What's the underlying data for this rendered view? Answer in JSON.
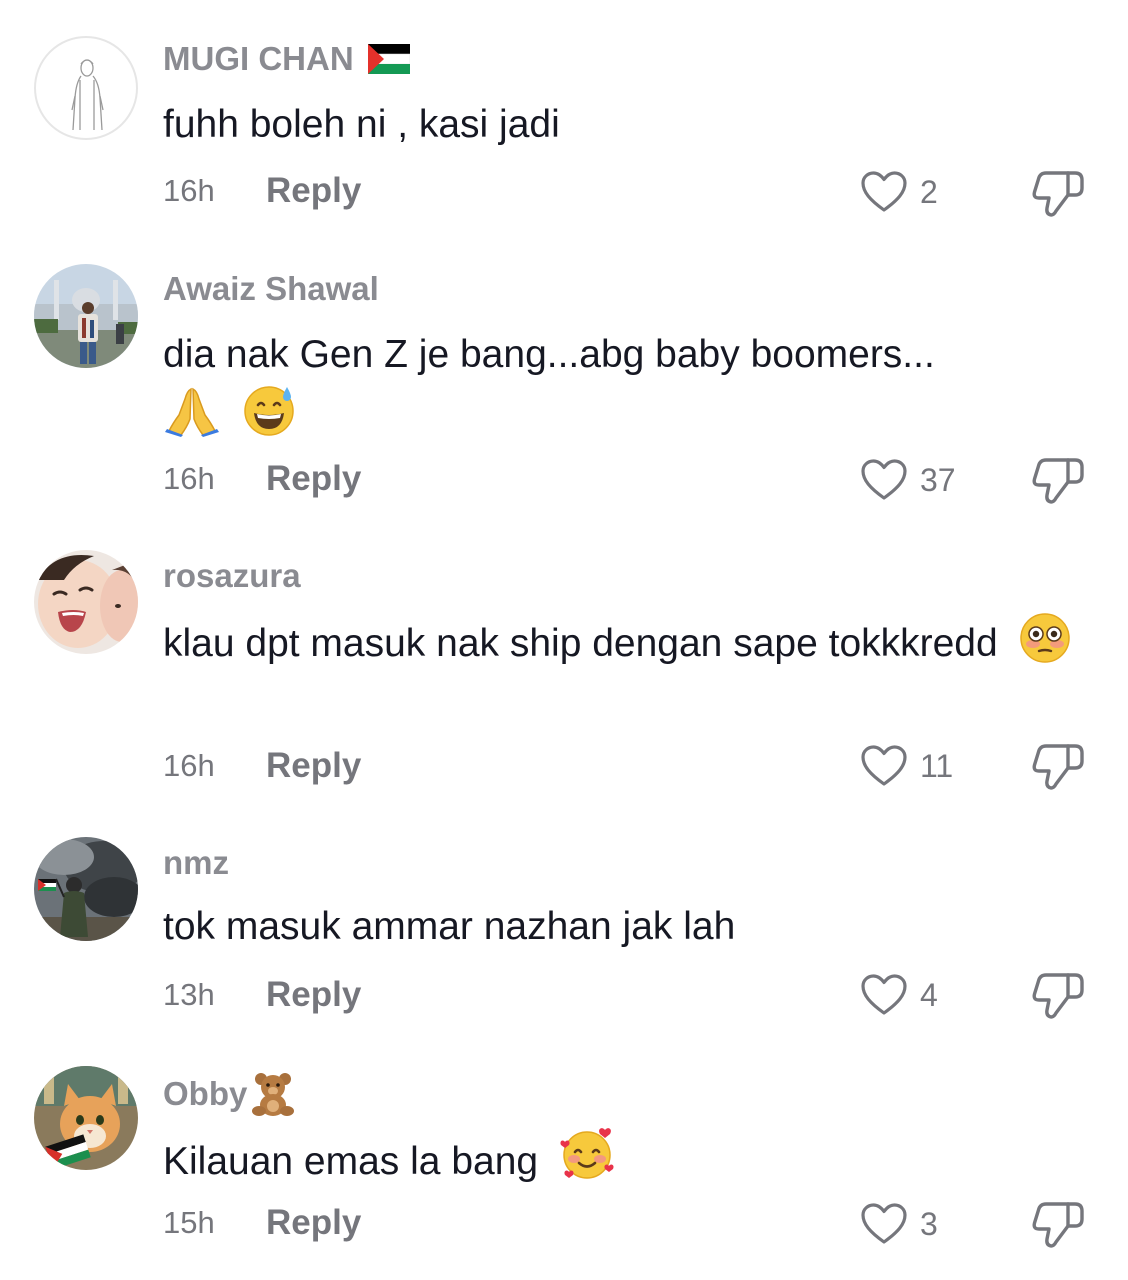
{
  "comments": [
    {
      "username": "MUGI CHAN",
      "username_emoji": "palestine-flag",
      "text": "fuhh boleh ni , kasi jadi",
      "text_emojis": [],
      "time": "16h",
      "reply_label": "Reply",
      "likes": "2"
    },
    {
      "username": "Awaiz Shawal",
      "text": "dia nak Gen Z je bang...abg baby boomers...",
      "text_emojis": [
        "folded-hands",
        "grinning-sweat"
      ],
      "time": "16h",
      "reply_label": "Reply",
      "likes": "37"
    },
    {
      "username": "rosazura",
      "text": "klau dpt masuk nak ship dengan sape tokkkredd",
      "text_emojis": [
        "flushed-face"
      ],
      "time": "16h",
      "reply_label": "Reply",
      "likes": "11"
    },
    {
      "username": "nmz",
      "text": "tok masuk ammar nazhan jak lah",
      "text_emojis": [],
      "time": "13h",
      "reply_label": "Reply",
      "likes": "4"
    },
    {
      "username": "Obby",
      "username_emoji": "teddy-bear",
      "text": "Kilauan emas la bang",
      "text_emojis": [
        "smiling-face-with-hearts"
      ],
      "time": "15h",
      "reply_label": "Reply",
      "likes": "3"
    }
  ],
  "colors": {
    "text": "#161823",
    "secondary": "#8a8b91",
    "meta": "#75767c"
  }
}
